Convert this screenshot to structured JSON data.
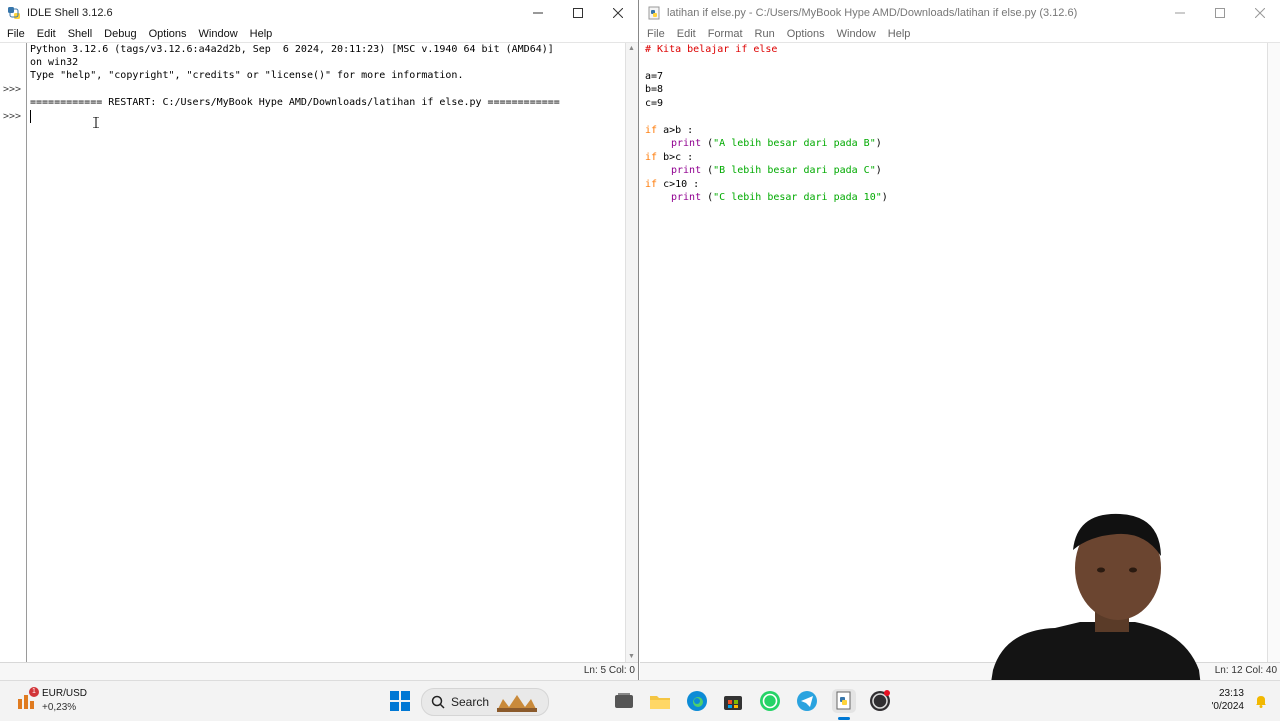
{
  "shell": {
    "title": "IDLE Shell 3.12.6",
    "menu": [
      "File",
      "Edit",
      "Shell",
      "Debug",
      "Options",
      "Window",
      "Help"
    ],
    "lines": [
      "Python 3.12.6 (tags/v3.12.6:a4a2d2b, Sep  6 2024, 20:11:23) [MSC v.1940 64 bit (AMD64)]",
      "on win32",
      "Type \"help\", \"copyright\", \"credits\" or \"license()\" for more information.",
      "",
      "============ RESTART: C:/Users/MyBook Hype AMD/Downloads/latihan if else.py ============",
      ""
    ],
    "prompts": [
      ">>>",
      ">>>"
    ],
    "status": "Ln: 5   Col: 0"
  },
  "editor": {
    "title": "latihan if else.py - C:/Users/MyBook Hype AMD/Downloads/latihan if else.py (3.12.6)",
    "menu": [
      "File",
      "Edit",
      "Format",
      "Run",
      "Options",
      "Window",
      "Help"
    ],
    "code": {
      "comment": "# Kita belajar if else",
      "assign_a": "a=7",
      "assign_b": "b=8",
      "assign_c": "c=9",
      "if1_kw": "if",
      "if1_cond": " a>b :",
      "print1_fn": "print",
      "print1_open": " (",
      "print1_str": "\"A lebih besar dari pada B\"",
      "print1_close": ")",
      "if2_kw": "if",
      "if2_cond": " b>c :",
      "print2_fn": "print",
      "print2_open": " (",
      "print2_str": "\"B lebih besar dari pada C\"",
      "print2_close": ")",
      "if3_kw": "if",
      "if3_cond": " c>10 :",
      "print3_fn": "print",
      "print3_open": " (",
      "print3_str": "\"C lebih besar dari pada 10\"",
      "print3_close": ")"
    },
    "status": "Ln: 12   Col: 40"
  },
  "taskbar": {
    "stock_badge": "1",
    "stock_name": "EUR/USD",
    "stock_change": "+0,23%",
    "search_label": "Search",
    "time": "23:13",
    "date": "'0/2024",
    "apps": [
      "windows-start",
      "search",
      "widgets-app",
      "task-view",
      "file-explorer",
      "edge",
      "store",
      "whatsapp",
      "telegram",
      "idle",
      "obs"
    ]
  },
  "colors": {
    "comment": "#dd0000",
    "keyword": "#ff7700",
    "string": "#00aa00",
    "builtin": "#900090",
    "accent": "#0078d4"
  }
}
